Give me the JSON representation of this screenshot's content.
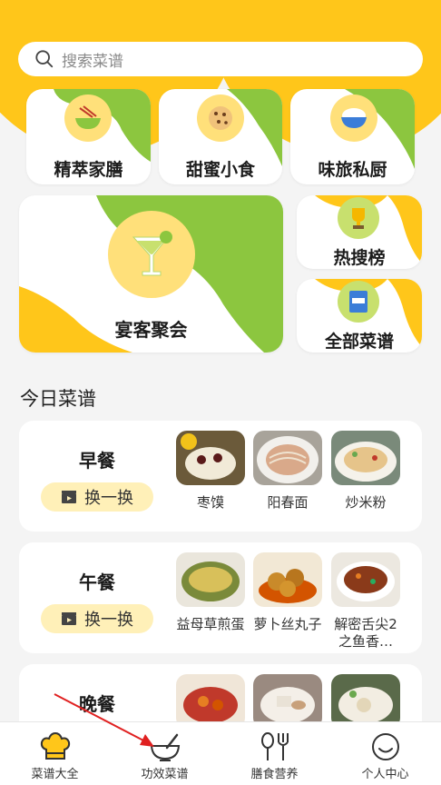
{
  "search": {
    "placeholder": "搜索菜谱"
  },
  "categories": [
    {
      "label": "精萃家膳",
      "icon": "noodle-bowl-icon"
    },
    {
      "label": "甜蜜小食",
      "icon": "cookie-icon"
    },
    {
      "label": "味旅私厨",
      "icon": "rice-bowl-icon"
    },
    {
      "label": "宴客聚会",
      "icon": "cocktail-icon"
    },
    {
      "label": "热搜榜",
      "icon": "trophy-icon"
    },
    {
      "label": "全部菜谱",
      "icon": "menu-book-icon"
    }
  ],
  "today": {
    "title": "今日菜谱",
    "swap_label": "换一换",
    "meals": [
      {
        "name": "早餐",
        "dishes": [
          "枣馍",
          "阳春面",
          "炒米粉"
        ]
      },
      {
        "name": "午餐",
        "dishes": [
          "益母草煎蛋",
          "萝卜丝丸子",
          "解密舌尖2之鱼香…"
        ]
      },
      {
        "name": "晚餐",
        "dishes": [
          "",
          "",
          ""
        ]
      }
    ]
  },
  "tabbar": [
    {
      "label": "菜谱大全",
      "icon": "chef-hat-icon",
      "active": true
    },
    {
      "label": "功效菜谱",
      "icon": "mortar-pestle-icon",
      "active": false
    },
    {
      "label": "膳食营养",
      "icon": "fork-spoon-icon",
      "active": false
    },
    {
      "label": "个人中心",
      "icon": "smiley-icon",
      "active": false
    }
  ],
  "colors": {
    "accent": "#ffc61a",
    "green": "#8cc63f",
    "icon_bg": "#ffe07a",
    "swap_bg": "#fff0b8",
    "annotation_arrow": "#e02020"
  }
}
